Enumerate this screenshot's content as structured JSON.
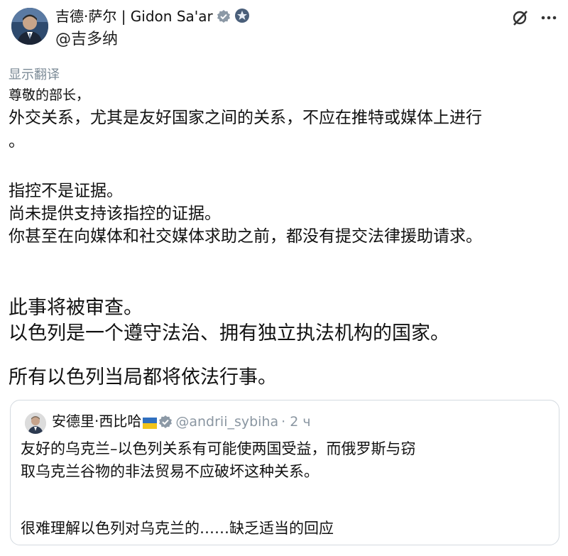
{
  "tweet": {
    "author_name": "吉德·萨尔 | Gidon Sa'ar",
    "handle": "@吉多纳",
    "translate_label": "显示翻译",
    "lines": [
      "尊敬的部长，",
      "外交关系，尤其是友好国家之间的关系，不应在推特或媒体上进行",
      "。",
      "指控不是证据。",
      "尚未提供支持该指控的证据。",
      "你甚至在向媒体和社交媒体求助之前，都没有提交法律援助请求。",
      "此事将被审查。",
      "以色列是一个遵守法治、拥有独立执法机构的国家。",
      "所有以色列当局都将依法行事。"
    ]
  },
  "quoted_tweet": {
    "author_name": "安德里·西比哈",
    "handle": "@andrii_sybiha",
    "time": "· 2 ч",
    "lines": [
      "友好的乌克兰–以色列关系有可能使两国受益，而俄罗斯与窃",
      "取乌克兰谷物的非法贸易不应破坏这种关系。",
      "很难理解以色列对乌克兰的……缺乏适当的回应"
    ]
  },
  "colors": {
    "verified_badge": "#8c99a6",
    "translate_text": "#7b8a96",
    "meta_text": "#8a96a1",
    "border": "#d4dae0"
  },
  "icons": [
    "verified-badge-icon",
    "government-emblem-icon",
    "grok-icon",
    "more-options-icon",
    "ukraine-flag-icon"
  ]
}
